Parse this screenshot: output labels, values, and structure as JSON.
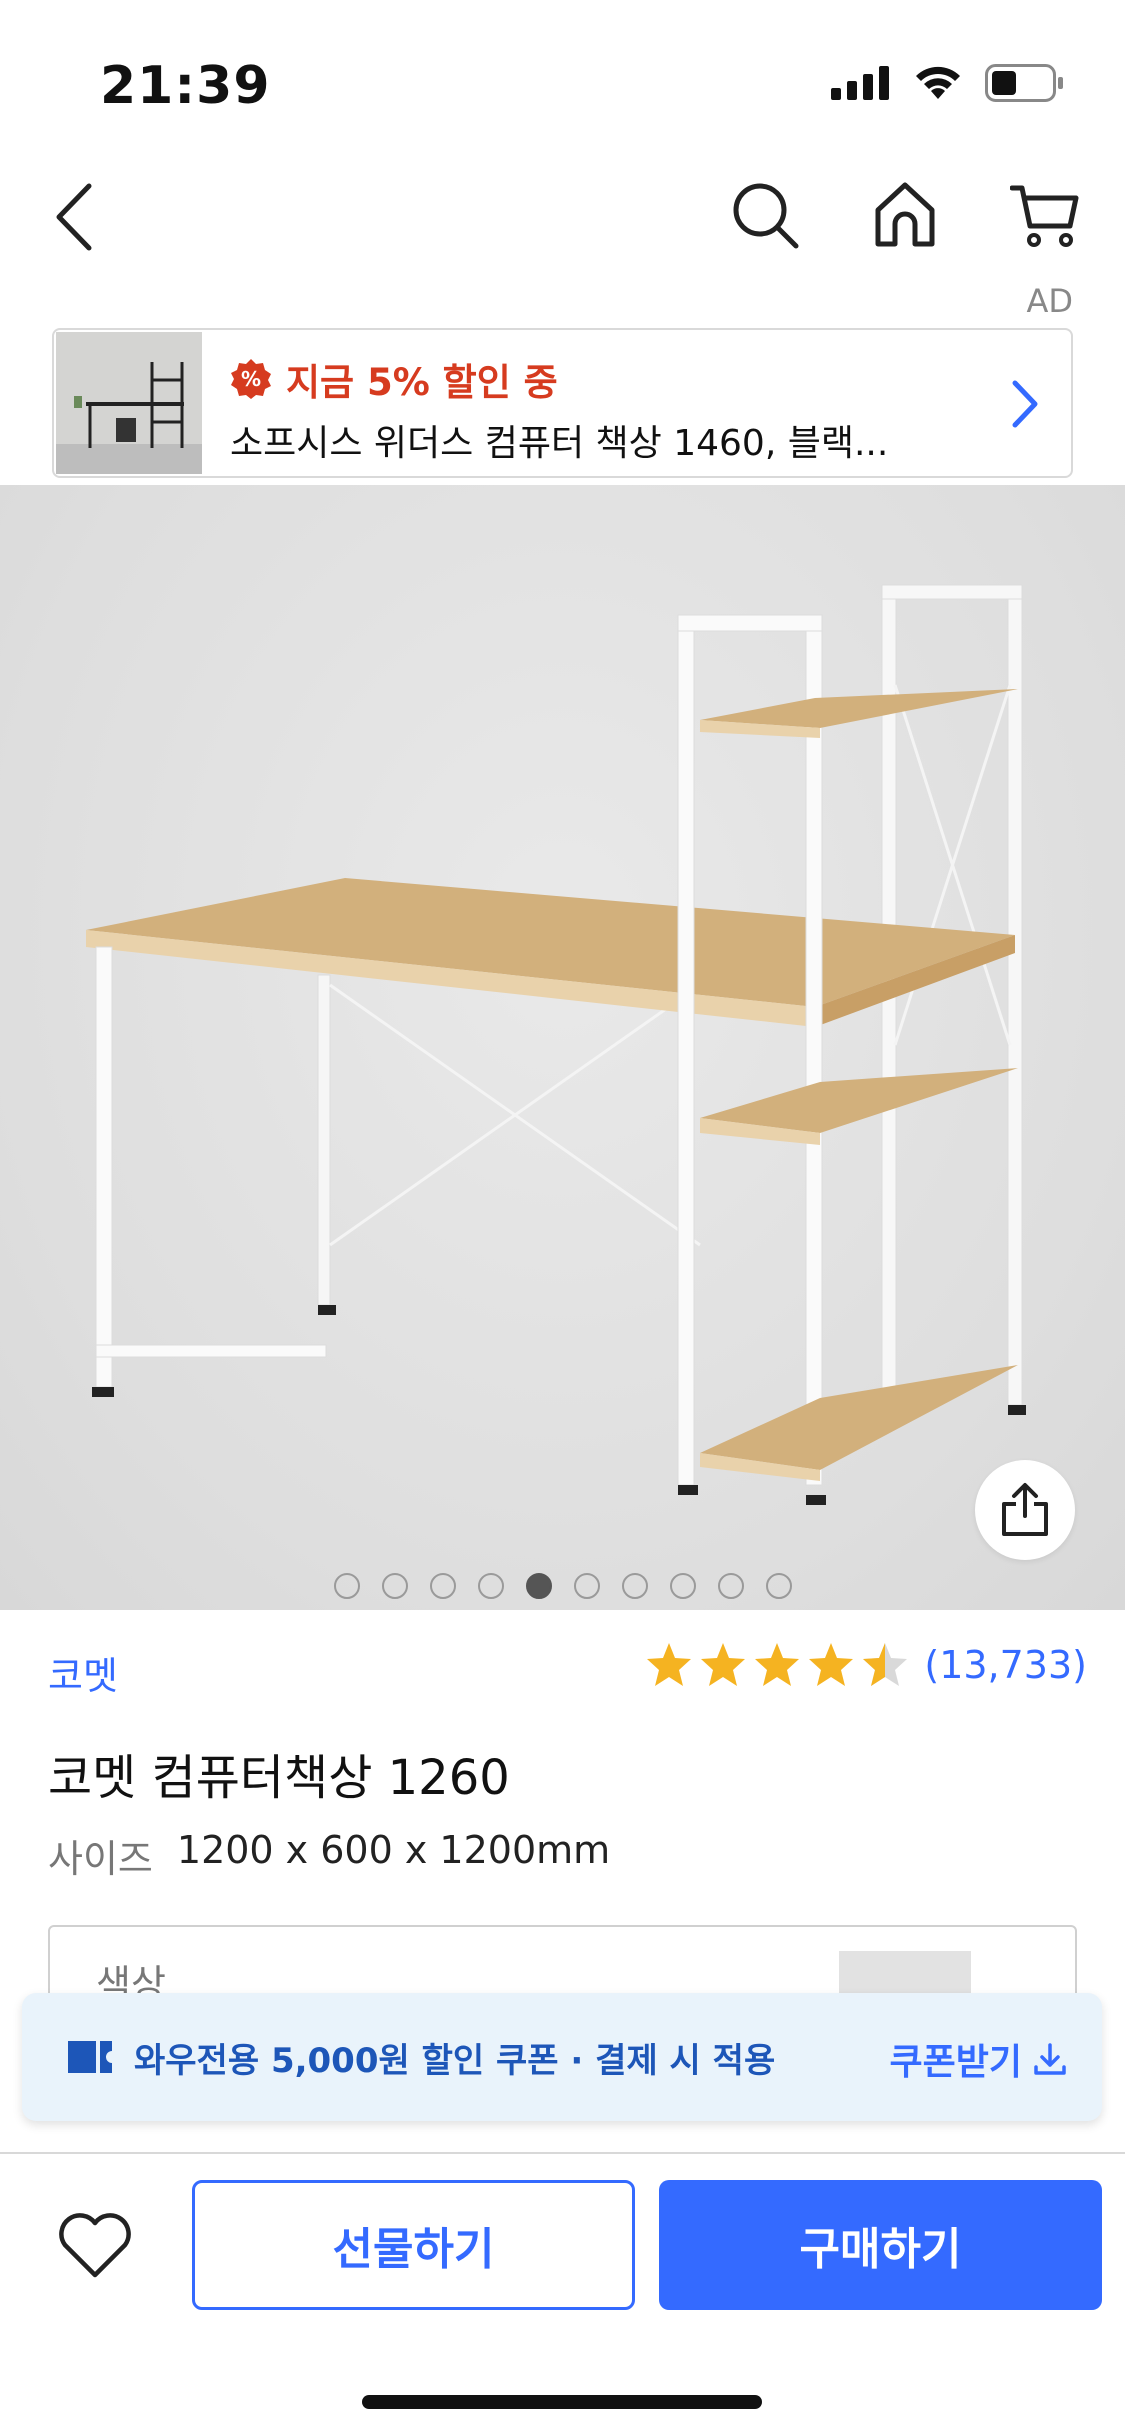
{
  "status_bar": {
    "time": "21:39"
  },
  "nav": {
    "back_icon": "chevron-left-icon",
    "search_icon": "search-icon",
    "home_icon": "home-icon",
    "cart_icon": "cart-icon"
  },
  "ad": {
    "label": "AD",
    "promo": "지금 5% 할인 중",
    "promo_color": "#d63b1f",
    "title": "소프시스 위더스 컴퓨터 책상 1460, 블랙..."
  },
  "product": {
    "image_count": 10,
    "active_image_index": 4,
    "brand": "코멧",
    "rating": 4.5,
    "review_count": "(13,733)",
    "title": "코멧 컴퓨터책상 1260",
    "size_label": "사이즈",
    "size_value": "1200 x 600 x 1200mm",
    "option_label": "색상"
  },
  "coupon": {
    "text": "와우전용 5,000원 할인 쿠폰 · 결제 시 적용",
    "action": "쿠폰받기"
  },
  "bottom_bar": {
    "gift_label": "선물하기",
    "buy_label": "구매하기"
  },
  "colors": {
    "accent": "#346aff",
    "star": "#f5b321"
  }
}
